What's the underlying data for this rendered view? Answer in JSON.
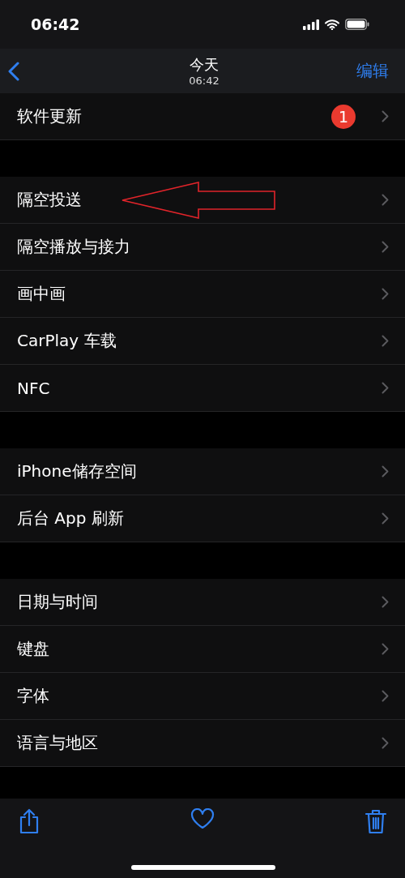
{
  "status_bar": {
    "time": "06:42"
  },
  "nav": {
    "title": "今天",
    "subtitle": "06:42",
    "action": "编辑"
  },
  "sections": [
    [
      {
        "label": "软件更新",
        "badge": "1",
        "marked": false
      }
    ],
    [
      {
        "label": "隔空投送",
        "marked": true
      },
      {
        "label": "隔空播放与接力",
        "marked": false
      },
      {
        "label": "画中画",
        "marked": false
      },
      {
        "label": "CarPlay 车载",
        "marked": false
      },
      {
        "label": "NFC",
        "marked": false
      }
    ],
    [
      {
        "label": "iPhone储存空间",
        "marked": false
      },
      {
        "label": "后台 App 刷新",
        "marked": false
      }
    ],
    [
      {
        "label": "日期与时间",
        "marked": false
      },
      {
        "label": "键盘",
        "marked": false
      },
      {
        "label": "字体",
        "marked": false
      },
      {
        "label": "语言与地区",
        "marked": false
      }
    ]
  ]
}
